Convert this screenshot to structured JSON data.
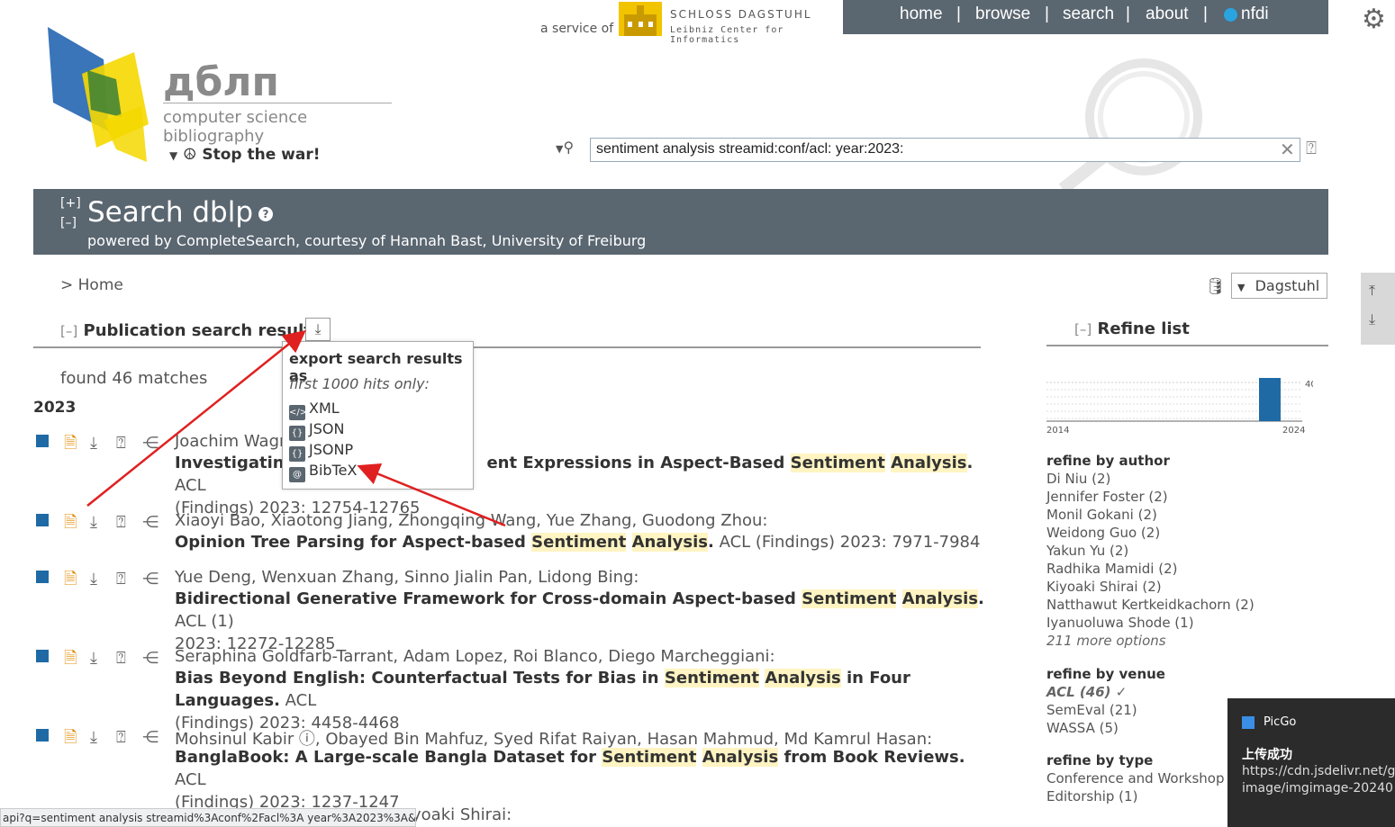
{
  "top": {
    "service_of": "a service of",
    "dagstuhl_name": "SCHLOSS DAGSTUHL",
    "dagstuhl_sub": "Leibniz Center for Informatics",
    "nav": [
      "home",
      "browse",
      "search",
      "about",
      "nfdi"
    ]
  },
  "logo": {
    "name": "дблп",
    "subtitle": "computer science bibliography",
    "stop_war": "Stop the war!"
  },
  "search": {
    "query": "sentiment analysis streamid:conf/acl: year:2023:"
  },
  "header": {
    "title": "Search dblp",
    "plus": "[+]",
    "minus": "[–]",
    "help": "?",
    "powered_prefix": "powered by ",
    "powered_engine": "CompleteSearch",
    "powered_mid": ", courtesy of ",
    "powered_person": "Hannah Bast",
    "powered_sep": ", ",
    "powered_org": "University of Freiburg"
  },
  "breadcrumb": "> Home",
  "mirror": "Dagstuhl",
  "results": {
    "section_title": "Publication search results",
    "toggle": "[–]",
    "found": "found 46 matches",
    "year": "2023",
    "entries": [
      {
        "authors": "Joachim Wagn",
        "title_pre": "Investigating",
        "title_mid": "ent Expressions in Aspect-Based ",
        "hl1": "Sentiment",
        "hl2": "Analysis",
        "title_post": ".",
        "venue": " ACL",
        "venue2": "(Findings) 2023: 12754-12765"
      },
      {
        "authors": "Xiaoyi Bao, Xiaotong Jiang, Zhongqing Wang, Yue Zhang, Guodong Zhou:",
        "title_pre": "Opinion Tree Parsing for Aspect-based ",
        "hl1": "Sentiment",
        "hl2": "Analysis",
        "title_post": ".",
        "venue": " ACL (Findings) 2023: 7971-7984"
      },
      {
        "authors": "Yue Deng, Wenxuan Zhang, Sinno Jialin Pan, Lidong Bing:",
        "title_pre": "Bidirectional Generative Framework for Cross-domain Aspect-based ",
        "hl1": "Sentiment",
        "hl2": "Analysis",
        "title_post": ".",
        "venue": " ACL (1)",
        "venue2": "2023: 12272-12285"
      },
      {
        "authors": "Seraphina Goldfarb-Tarrant, Adam Lopez, Roi Blanco, Diego Marcheggiani:",
        "title_pre": "Bias Beyond English: Counterfactual Tests for Bias in ",
        "hl1": "Sentiment",
        "hl2": "Analysis",
        "title_post": " in Four Languages.",
        "venue": " ACL",
        "venue2": "(Findings) 2023: 4458-4468"
      },
      {
        "authors": "Mohsinul Kabir ⓘ, Obayed Bin Mahfuz, Syed Rifat Raiyan, Hasan Mahmud, Md Kamrul Hasan:",
        "title_pre": "BanglaBook: A Large-scale Bangla Dataset for ",
        "hl1": "Sentiment",
        "hl2": "Analysis",
        "title_post": " from Book Reviews.",
        "venue": " ACL",
        "venue2": "(Findings) 2023: 1237-1247"
      },
      {
        "authors": "yoaki Shirai:"
      }
    ]
  },
  "export_popup": {
    "heading": "export search results as",
    "note": "first 1000 hits only:",
    "options": [
      {
        "label": "XML",
        "icon": "</>"
      },
      {
        "label": "JSON",
        "icon": "{}"
      },
      {
        "label": "JSONP",
        "icon": "{}"
      },
      {
        "label": "BibTeX",
        "icon": "@"
      }
    ]
  },
  "refine": {
    "title": "Refine list",
    "toggle": "[–]",
    "hist_start": "2014",
    "hist_end": "2024",
    "hist_max": "40",
    "hist_value": 46,
    "by_author": "refine by author",
    "authors": [
      "Di Niu (2)",
      "Jennifer Foster (2)",
      "Monil Gokani (2)",
      "Weidong Guo (2)",
      "Yakun Yu (2)",
      "Radhika Mamidi (2)",
      "Kiyoaki Shirai (2)",
      "Natthawut Kertkeidkachorn (2)",
      "Iyanuoluwa Shode (1)"
    ],
    "authors_more": "211 more options",
    "by_venue": "refine by venue",
    "venue_selected": "ACL (46) ✓",
    "venues": [
      "SemEval (21)",
      "WASSA (5)"
    ],
    "by_type": "refine by type",
    "types": [
      "Conference and Workshop P",
      "Editorship (1)"
    ]
  },
  "statusbar": "api?q=sentiment analysis streamid%3Aconf%2Facl%3A year%3A2023%3A&h...",
  "toast": {
    "app": "PicGo",
    "title": "上传成功",
    "msg1": "https://cdn.jsdelivr.net/g",
    "msg2": "image/imgimage-20240"
  },
  "colors": {
    "nav_bg": "#5a6670",
    "highlight": "#fff4c2",
    "marker": "#1f6aa5",
    "arrow": "#e02020"
  }
}
